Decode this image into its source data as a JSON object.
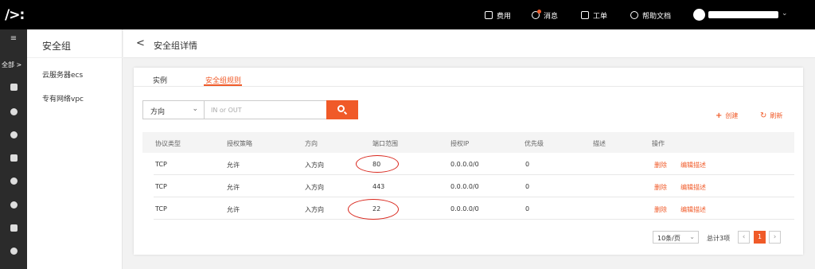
{
  "topbar": {
    "logo": "/>:",
    "items": [
      {
        "label": "费用",
        "icon": "bill-icon"
      },
      {
        "label": "消息",
        "icon": "message-icon"
      },
      {
        "label": "工单",
        "icon": "ticket-icon"
      },
      {
        "label": "帮助文档",
        "icon": "help-icon"
      }
    ]
  },
  "leftnav": {
    "all_label": "全部 >",
    "icons": [
      "menu-icon",
      "home-icon",
      "database-icon",
      "globe-icon",
      "storage-icon",
      "cloud-upload-icon",
      "cloud-icon",
      "close-box-icon",
      "db-stack-icon"
    ]
  },
  "sidemenu": {
    "title": "安全组",
    "items": [
      "云服务器ecs",
      "专有网络vpc"
    ]
  },
  "header": {
    "back": "<",
    "title": "安全组详情"
  },
  "tabs": [
    "实例",
    "安全组规则"
  ],
  "filter": {
    "direction_value": "方向",
    "search_placeholder": "IN or OUT"
  },
  "actions": {
    "create": "创建",
    "refresh": "刷新"
  },
  "table": {
    "columns": [
      "协议类型",
      "授权策略",
      "方向",
      "端口范围",
      "授权IP",
      "优先级",
      "描述",
      "操作"
    ],
    "rows": [
      {
        "protocol": "TCP",
        "policy": "允许",
        "direction": "入方向",
        "port": "80",
        "ip": "0.0.0.0/0",
        "priority": "0",
        "desc": "",
        "delete": "删除",
        "edit": "编辑描述"
      },
      {
        "protocol": "TCP",
        "policy": "允许",
        "direction": "入方向",
        "port": "443",
        "ip": "0.0.0.0/0",
        "priority": "0",
        "desc": "",
        "delete": "删除",
        "edit": "编辑描述"
      },
      {
        "protocol": "TCP",
        "policy": "允许",
        "direction": "入方向",
        "port": "22",
        "ip": "0.0.0.0/0",
        "priority": "0",
        "desc": "",
        "delete": "删除",
        "edit": "编辑描述"
      }
    ]
  },
  "pagination": {
    "page_size": "10条/页",
    "total": "总计3项",
    "current_page": "1"
  },
  "colors": {
    "accent": "#f05a28",
    "annotation": "#d9261c",
    "topbar": "#000000",
    "leftnav": "#2b2b2b"
  }
}
